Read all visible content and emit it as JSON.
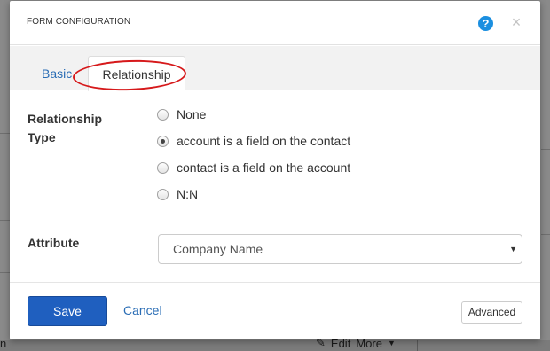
{
  "modal": {
    "title": "FORM CONFIGURATION",
    "help_symbol": "?",
    "close_symbol": "×"
  },
  "tabs": [
    {
      "label": "Basic",
      "active": false
    },
    {
      "label": "Relationship",
      "active": true
    }
  ],
  "form": {
    "relationship_type_label_line1": "Relationship",
    "relationship_type_label_line2": "Type",
    "options": [
      {
        "label": "None",
        "checked": false
      },
      {
        "label": "account is a field on the contact",
        "checked": true
      },
      {
        "label": "contact is a field on the account",
        "checked": false
      },
      {
        "label": "N:N",
        "checked": false
      }
    ],
    "attribute_label": "Attribute",
    "attribute_value": "Company Name",
    "attribute_arrow": "▼"
  },
  "footer": {
    "save_label": "Save",
    "cancel_label": "Cancel",
    "advanced_label": "Advanced"
  },
  "background": {
    "bottom_left_text": "n",
    "edit_label": "Edit",
    "more_label": "More"
  },
  "colors": {
    "primary_button": "#1f5fbf",
    "link": "#2a6db5",
    "help_icon": "#1b8fe0",
    "annotation": "#d6191b"
  }
}
